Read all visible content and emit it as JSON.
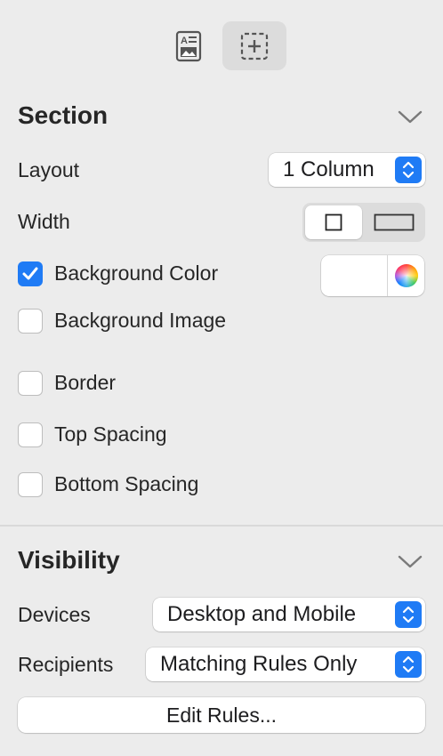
{
  "toolbar": {
    "icons": [
      "document-format-icon",
      "add-section-icon"
    ],
    "selected": "add-section-icon"
  },
  "section": {
    "title": "Section",
    "layout_label": "Layout",
    "layout_value": "1 Column",
    "width_label": "Width",
    "width_options": [
      "narrow-width-icon",
      "full-width-icon"
    ],
    "width_selected": "narrow-width-icon",
    "background_color_label": "Background Color",
    "background_color_checked": true,
    "background_color_value": "#ffffff",
    "background_image_label": "Background Image",
    "background_image_checked": false,
    "border_label": "Border",
    "border_checked": false,
    "top_spacing_label": "Top Spacing",
    "top_spacing_checked": false,
    "bottom_spacing_label": "Bottom Spacing",
    "bottom_spacing_checked": false
  },
  "visibility": {
    "title": "Visibility",
    "devices_label": "Devices",
    "devices_value": "Desktop and Mobile",
    "recipients_label": "Recipients",
    "recipients_value": "Matching Rules Only",
    "edit_rules_label": "Edit Rules..."
  },
  "colors": {
    "accent": "#1f7bf5",
    "background": "#ececec"
  }
}
